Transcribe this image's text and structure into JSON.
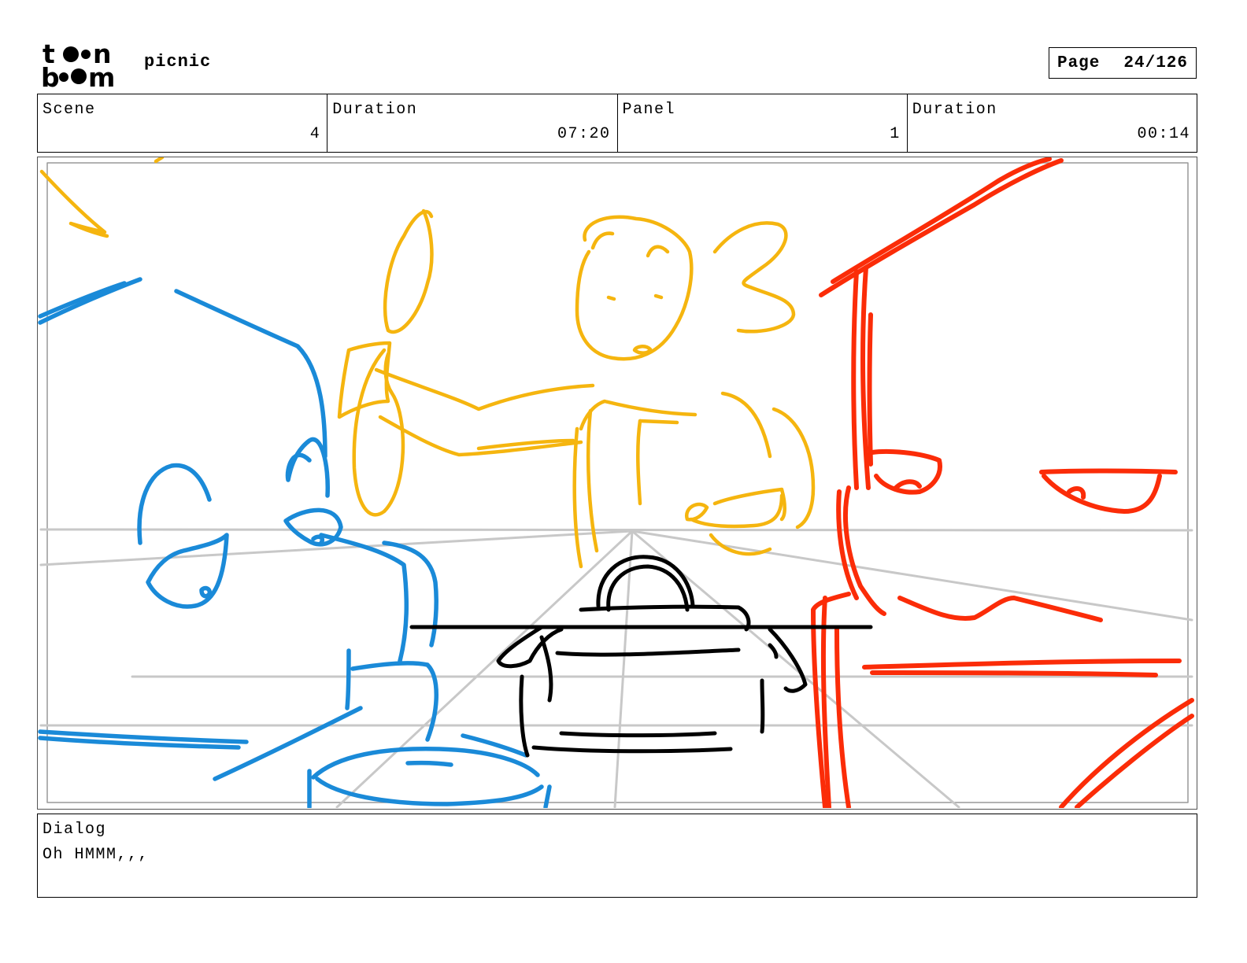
{
  "header": {
    "logo_text_line1": "toon",
    "logo_text_line2": "boom",
    "project_title": "picnic",
    "page_label": "Page",
    "page_value": "24/126"
  },
  "info": {
    "scene_label": "Scene",
    "scene_value": "4",
    "scene_duration_label": "Duration",
    "scene_duration_value": "07:20",
    "panel_label": "Panel",
    "panel_value": "1",
    "panel_duration_label": "Duration",
    "panel_duration_value": "00:14"
  },
  "panel": {
    "colors": {
      "blue": "#1a8ad8",
      "yellow": "#f5b50f",
      "red": "#fb2c08",
      "black": "#000000",
      "guide": "#c8c8c8"
    }
  },
  "dialog": {
    "label": "Dialog",
    "text": "Oh HMMM,,,"
  }
}
